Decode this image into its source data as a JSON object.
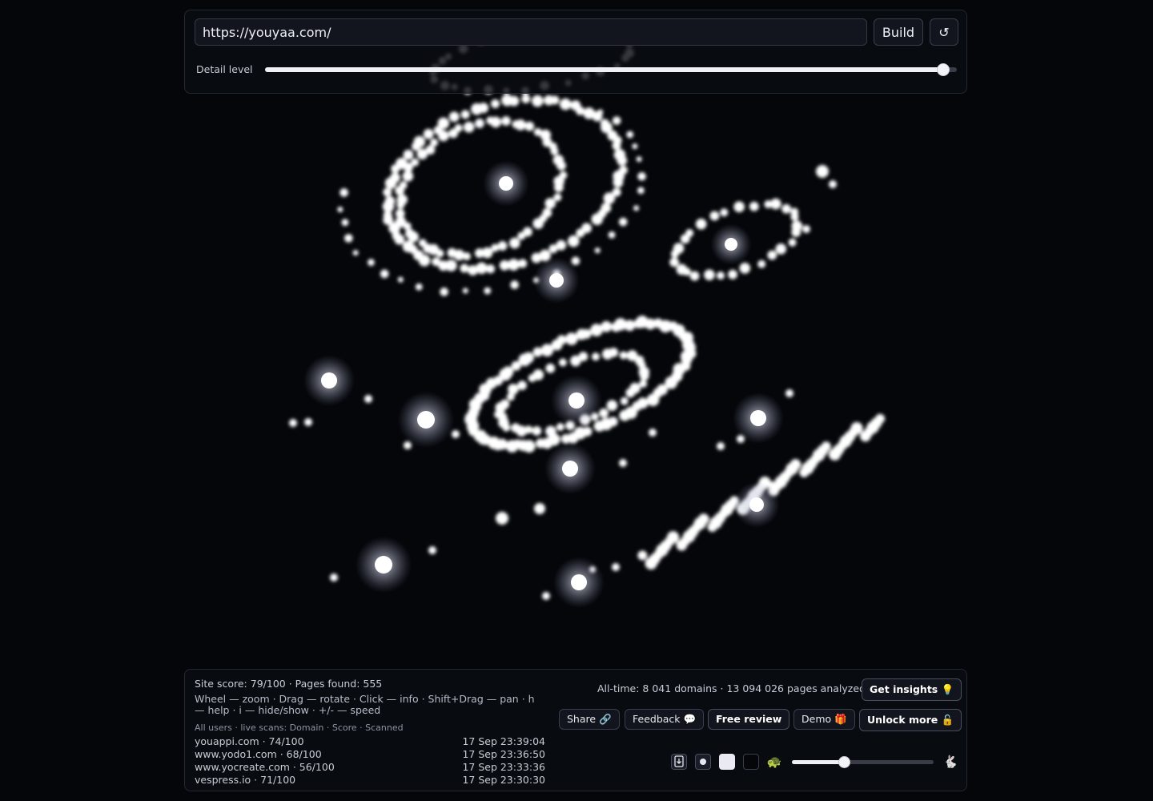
{
  "top": {
    "url_value": "https://youyaa.com/",
    "build_label": "Build",
    "reset_label": "↺",
    "detail_label": "Detail level",
    "detail_level_fraction": 0.98
  },
  "bottom": {
    "site_score": "Site score: 79/100 · Pages found: 555",
    "help": "Wheel — zoom · Drag — rotate · Click — info · Shift+Drag — pan · h — help · i — hide/show · +/- — speed",
    "scans_header": "All users · live scans: Domain · Score · Scanned",
    "scans": [
      {
        "domain": "youappi.com · 74/100",
        "time": "17 Sep 23:39:04"
      },
      {
        "domain": "www.yodo1.com · 68/100",
        "time": "17 Sep 23:36:50"
      },
      {
        "domain": "www.yocreate.com · 56/100",
        "time": "17 Sep 23:33:36"
      },
      {
        "domain": "vespress.io · 71/100",
        "time": "17 Sep 23:30:30"
      }
    ],
    "alltime": "All-time: 8 041 domains · 13 094 026 pages analyzed",
    "insights_label": "Get insights 💡",
    "share_label": "Share 🔗",
    "feedback_label": "Feedback 💬",
    "review_label": "Free review",
    "demo_label": "Demo 🎁",
    "unlock_label": "Unlock more 🔓",
    "speed_fraction": 0.37,
    "turtle_icon": "🐢",
    "rabbit_icon": "🐇"
  },
  "colors": {
    "background": "#05060a",
    "particle": "#ffffff",
    "panel_border": "#242734"
  }
}
